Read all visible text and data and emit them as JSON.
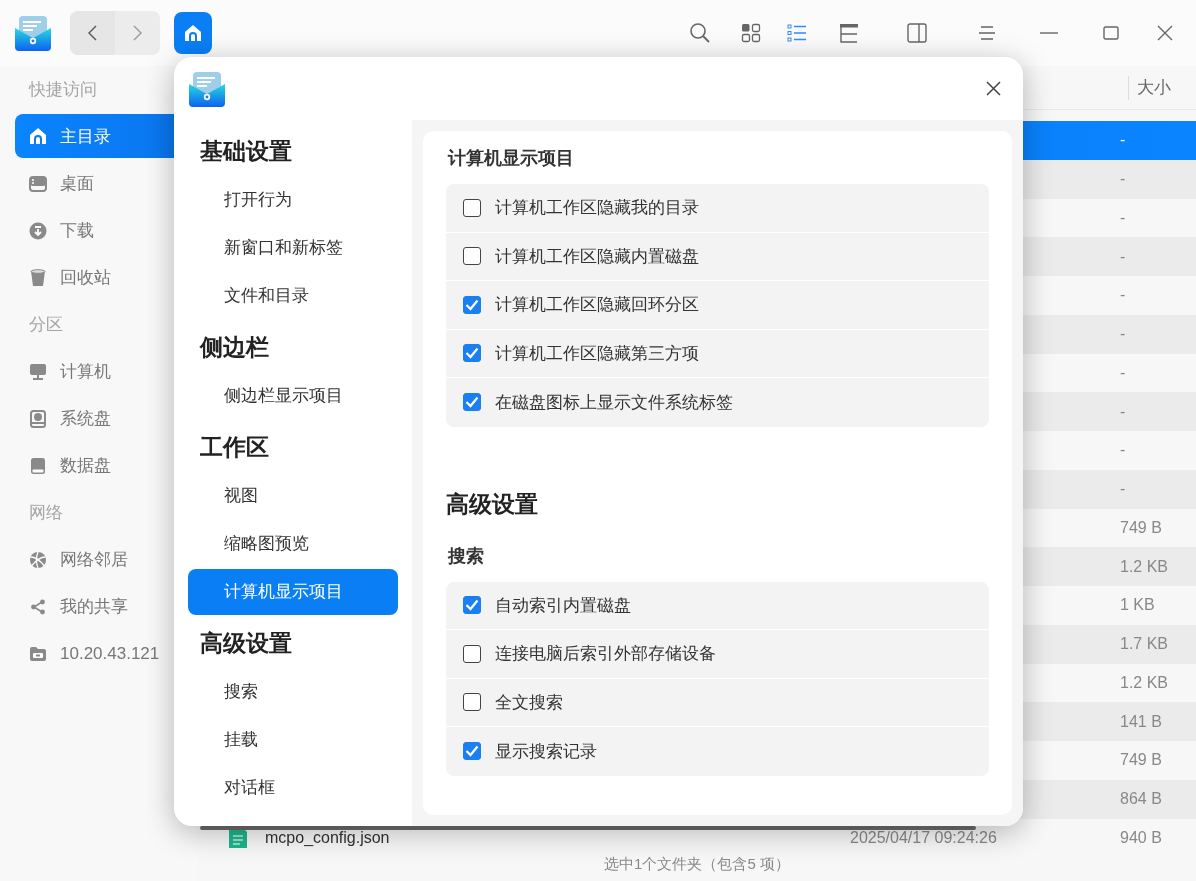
{
  "toolbar": {
    "buttons": [
      {
        "kind": "search",
        "selected": false
      },
      {
        "kind": "icons",
        "selected": false
      },
      {
        "kind": "list",
        "selected": true
      },
      {
        "kind": "tree",
        "selected": false
      },
      {
        "kind": "panel",
        "selected": false
      },
      {
        "kind": "menu",
        "selected": false
      },
      {
        "kind": "minimize",
        "selected": false
      },
      {
        "kind": "maximize",
        "selected": false
      },
      {
        "kind": "close",
        "selected": false
      }
    ]
  },
  "sidebar": {
    "groups": [
      {
        "title": "快捷访问",
        "items": [
          {
            "kind": "home",
            "label": "主目录",
            "selected": true
          },
          {
            "kind": "desktop",
            "label": "桌面",
            "selected": false
          },
          {
            "kind": "download",
            "label": "下载",
            "selected": false
          },
          {
            "kind": "trash",
            "label": "回收站",
            "selected": false
          }
        ]
      },
      {
        "title": "分区",
        "items": [
          {
            "kind": "computer",
            "label": "计算机",
            "selected": false
          },
          {
            "kind": "sysdisk",
            "label": "系统盘",
            "selected": false
          },
          {
            "kind": "disk",
            "label": "数据盘",
            "selected": false
          }
        ]
      },
      {
        "title": "网络",
        "items": [
          {
            "kind": "network",
            "label": "网络邻居",
            "selected": false
          },
          {
            "kind": "share",
            "label": "我的共享",
            "selected": false
          },
          {
            "kind": "server",
            "label": "10.20.43.121",
            "selected": false
          }
        ]
      }
    ]
  },
  "file_list": {
    "size_header": "大小",
    "rows": [
      {
        "size": "-",
        "selected": true
      },
      {
        "size": "-",
        "selected": false
      },
      {
        "size": "-",
        "selected": false
      },
      {
        "size": "-",
        "selected": false
      },
      {
        "size": "-",
        "selected": false
      },
      {
        "size": "-",
        "selected": false
      },
      {
        "size": "-",
        "selected": false
      },
      {
        "size": "-",
        "selected": false
      },
      {
        "size": "-",
        "selected": false
      },
      {
        "size": "-",
        "selected": false
      },
      {
        "size": "749 B",
        "selected": false
      },
      {
        "size": "1.2 KB",
        "selected": false
      },
      {
        "size": "1 KB",
        "selected": false
      },
      {
        "size": "1.7 KB",
        "selected": false
      },
      {
        "size": "1.2 KB",
        "selected": false
      },
      {
        "size": "141 B",
        "selected": false
      },
      {
        "size": "749 B",
        "selected": false
      },
      {
        "size": "864 B",
        "selected": false
      },
      {
        "name": "mcpo_config.json",
        "modified": "2025/04/17 09:24:26",
        "size": "940 B",
        "selected": false
      }
    ]
  },
  "status_bar": "选中1个文件夹（包含5 项）",
  "settings_dialog": {
    "nav": [
      {
        "title": "基础设置",
        "items": [
          {
            "label": "打开行为",
            "selected": false
          },
          {
            "label": "新窗口和新标签",
            "selected": false
          },
          {
            "label": "文件和目录",
            "selected": false
          }
        ]
      },
      {
        "title": "侧边栏",
        "items": [
          {
            "label": "侧边栏显示项目",
            "selected": false
          }
        ]
      },
      {
        "title": "工作区",
        "items": [
          {
            "label": "视图",
            "selected": false
          },
          {
            "label": "缩略图预览",
            "selected": false
          },
          {
            "label": "计算机显示项目",
            "selected": true
          }
        ]
      },
      {
        "title": "高级设置",
        "items": [
          {
            "label": "搜索",
            "selected": false
          },
          {
            "label": "挂载",
            "selected": false
          },
          {
            "label": "对话框",
            "selected": false
          }
        ]
      }
    ],
    "content": [
      {
        "kind": "subsection",
        "title": "计算机显示项目",
        "options": [
          {
            "label": "计算机工作区隐藏我的目录",
            "checked": false
          },
          {
            "label": "计算机工作区隐藏内置磁盘",
            "checked": false
          },
          {
            "label": "计算机工作区隐藏回环分区",
            "checked": true
          },
          {
            "label": "计算机工作区隐藏第三方项",
            "checked": true
          },
          {
            "label": "在磁盘图标上显示文件系统标签",
            "checked": true
          }
        ]
      },
      {
        "kind": "heading",
        "title": "高级设置"
      },
      {
        "kind": "subsection",
        "title": "搜索",
        "options": [
          {
            "label": "自动索引内置磁盘",
            "checked": true
          },
          {
            "label": "连接电脑后索引外部存储设备",
            "checked": false
          },
          {
            "label": "全文搜索",
            "checked": false
          },
          {
            "label": "显示搜索记录",
            "checked": true
          }
        ]
      }
    ]
  }
}
